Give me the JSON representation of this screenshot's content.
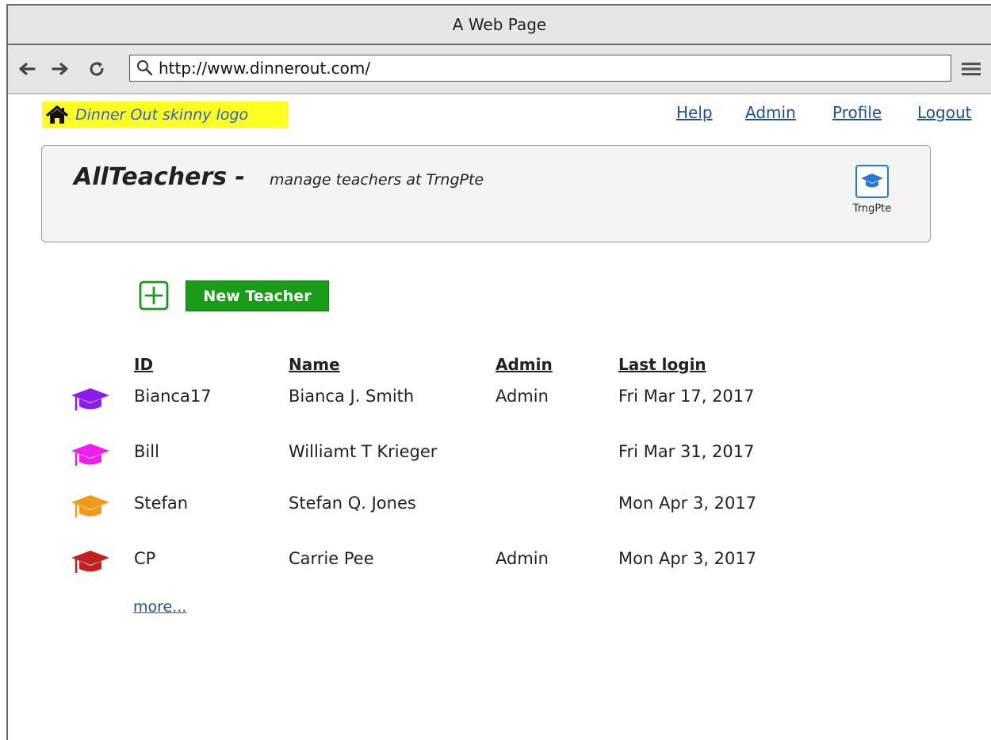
{
  "browser": {
    "window_title": "A Web Page",
    "url": "http://www.dinnerout.com/",
    "icons": [
      "back-arrow-icon",
      "forward-arrow-icon",
      "reload-icon",
      "search-icon",
      "hamburger-menu-icon"
    ]
  },
  "site": {
    "logo_text": "Dinner Out skinny logo",
    "logo_icon": "home-icon",
    "links": [
      "Help",
      "Admin",
      "Profile",
      "Logout"
    ]
  },
  "header": {
    "title": "AllTeachers -",
    "subtitle": "manage teachers at TrngPte",
    "org_label": "TrngPte",
    "org_icon": "graduation-cap-icon",
    "org_color": "#2a77d6"
  },
  "actions": {
    "new_teacher_label": "New Teacher",
    "new_teacher_color": "#1a9b1a",
    "plus_icon": "plus-square-icon"
  },
  "table": {
    "columns": [
      "ID",
      "Name",
      "Admin",
      "Last login"
    ],
    "rows": [
      {
        "id": "Bianca17",
        "name": "Bianca J. Smith",
        "admin": "Admin",
        "last_login": "Fri Mar 17, 2017",
        "icon_color": "#8a1cf0"
      },
      {
        "id": "Bill",
        "name": "Williamt T Krieger",
        "admin": "",
        "last_login": "Fri Mar 31, 2017",
        "icon_color": "#f01cf0"
      },
      {
        "id": "Stefan",
        "name": "Stefan Q. Jones",
        "admin": "",
        "last_login": "Mon Apr 3, 2017",
        "icon_color": "#f39a1a"
      },
      {
        "id": "CP",
        "name": "Carrie Pee",
        "admin": "Admin",
        "last_login": "Mon Apr 3, 2017",
        "icon_color": "#c42020"
      }
    ],
    "more_label": "more..."
  }
}
